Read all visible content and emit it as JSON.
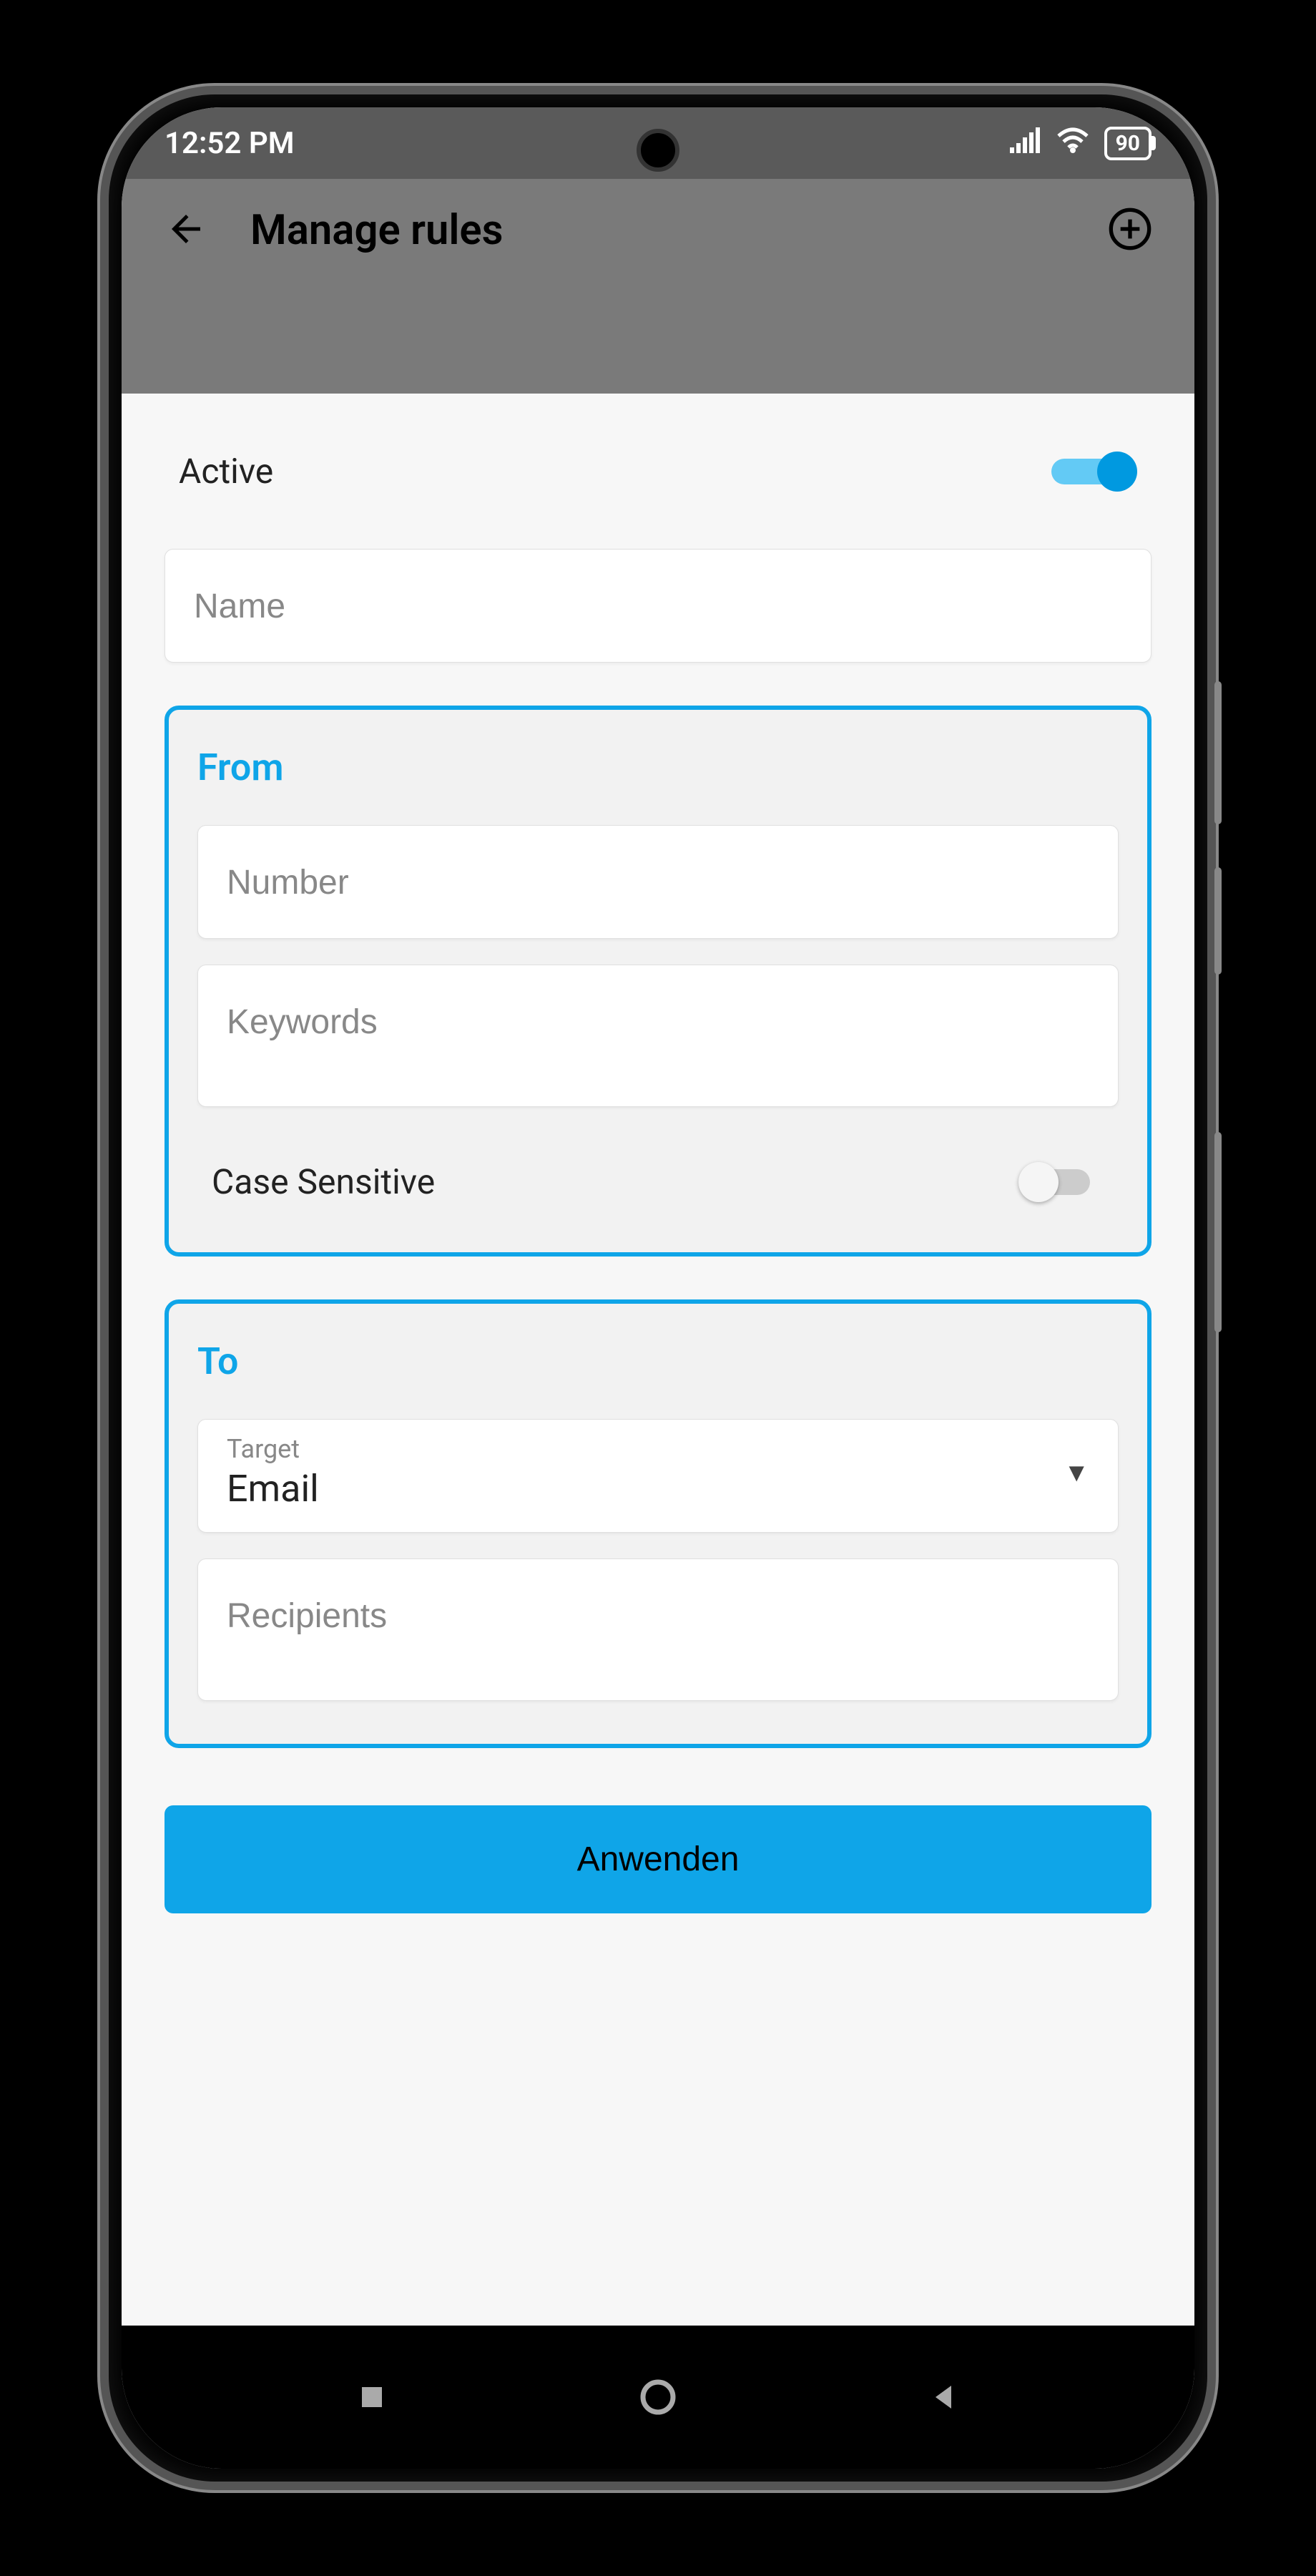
{
  "status": {
    "time": "12:52 PM",
    "battery": "90"
  },
  "appbar": {
    "title": "Manage rules"
  },
  "form": {
    "active_label": "Active",
    "name_placeholder": "Name",
    "from": {
      "title": "From",
      "number_placeholder": "Number",
      "keywords_placeholder": "Keywords",
      "case_sensitive_label": "Case Sensitive"
    },
    "to": {
      "title": "To",
      "target_label": "Target",
      "target_value": "Email",
      "recipients_placeholder": "Recipients"
    },
    "apply_label": "Anwenden"
  }
}
